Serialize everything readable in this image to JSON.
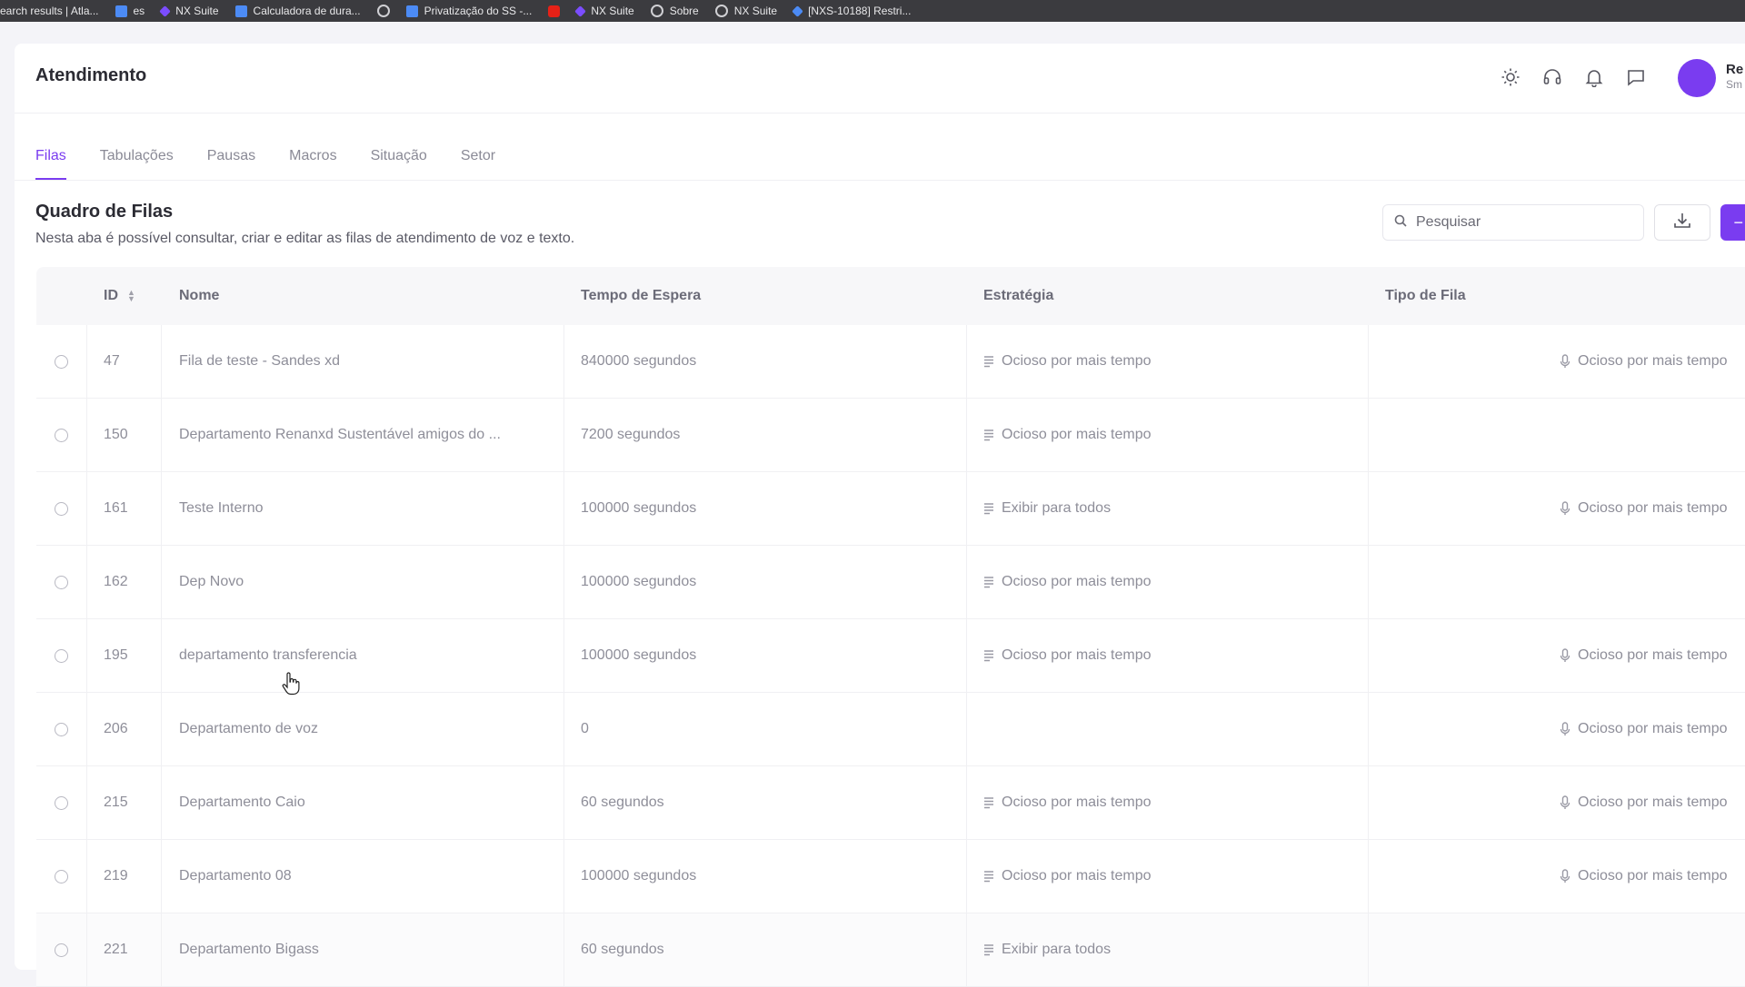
{
  "bookmarks": [
    {
      "label": "earch results | Atla...",
      "icon": "none"
    },
    {
      "label": "es",
      "icon": "doc"
    },
    {
      "label": "NX Suite",
      "icon": "purple"
    },
    {
      "label": "Calculadora de dura...",
      "icon": "doc"
    },
    {
      "label": "",
      "icon": "globe"
    },
    {
      "label": "Privatização do SS -...",
      "icon": "doc"
    },
    {
      "label": "",
      "icon": "yt"
    },
    {
      "label": "NX Suite",
      "icon": "purple"
    },
    {
      "label": "Sobre",
      "icon": "globe"
    },
    {
      "label": "NX Suite",
      "icon": "globe"
    },
    {
      "label": "[NXS-10188] Restri...",
      "icon": "jira"
    }
  ],
  "header": {
    "title": "Atendimento",
    "user_name": "Re",
    "user_sub": "Sm"
  },
  "tabs": [
    "Filas",
    "Tabulações",
    "Pausas",
    "Macros",
    "Situação",
    "Setor"
  ],
  "section": {
    "title": "Quadro de Filas",
    "description": "Nesta aba é possível consultar, criar e editar as filas de atendimento de voz e texto."
  },
  "search": {
    "placeholder": "Pesquisar"
  },
  "table": {
    "columns": [
      "ID",
      "Nome",
      "Tempo de Espera",
      "Estratégia",
      "Tipo de Fila"
    ],
    "rows": [
      {
        "id": "47",
        "nome": "Fila de teste - Sandes xd",
        "tempo": "840000 segundos",
        "estrategia": "Ocioso por mais tempo",
        "tipo": "Ocioso por mais tempo"
      },
      {
        "id": "150",
        "nome": "Departamento Renanxd Sustentável amigos do ...",
        "tempo": "7200 segundos",
        "estrategia": "Ocioso por mais tempo",
        "tipo": ""
      },
      {
        "id": "161",
        "nome": "Teste Interno",
        "tempo": "100000 segundos",
        "estrategia": "Exibir para todos",
        "tipo": "Ocioso por mais tempo"
      },
      {
        "id": "162",
        "nome": "Dep Novo",
        "tempo": "100000 segundos",
        "estrategia": "Ocioso por mais tempo",
        "tipo": ""
      },
      {
        "id": "195",
        "nome": "departamento transferencia",
        "tempo": "100000 segundos",
        "estrategia": "Ocioso por mais tempo",
        "tipo": "Ocioso por mais tempo"
      },
      {
        "id": "206",
        "nome": "Departamento de voz",
        "tempo": "0",
        "estrategia": "",
        "tipo": "Ocioso por mais tempo"
      },
      {
        "id": "215",
        "nome": "Departamento Caio",
        "tempo": "60 segundos",
        "estrategia": "Ocioso por mais tempo",
        "tipo": "Ocioso por mais tempo"
      },
      {
        "id": "219",
        "nome": "Departamento 08",
        "tempo": "100000 segundos",
        "estrategia": "Ocioso por mais tempo",
        "tipo": "Ocioso por mais tempo"
      },
      {
        "id": "221",
        "nome": "Departamento Bigass",
        "tempo": "60 segundos",
        "estrategia": "Exibir para todos",
        "tipo": ""
      }
    ]
  },
  "colors": {
    "accent": "#7a3cf0"
  }
}
